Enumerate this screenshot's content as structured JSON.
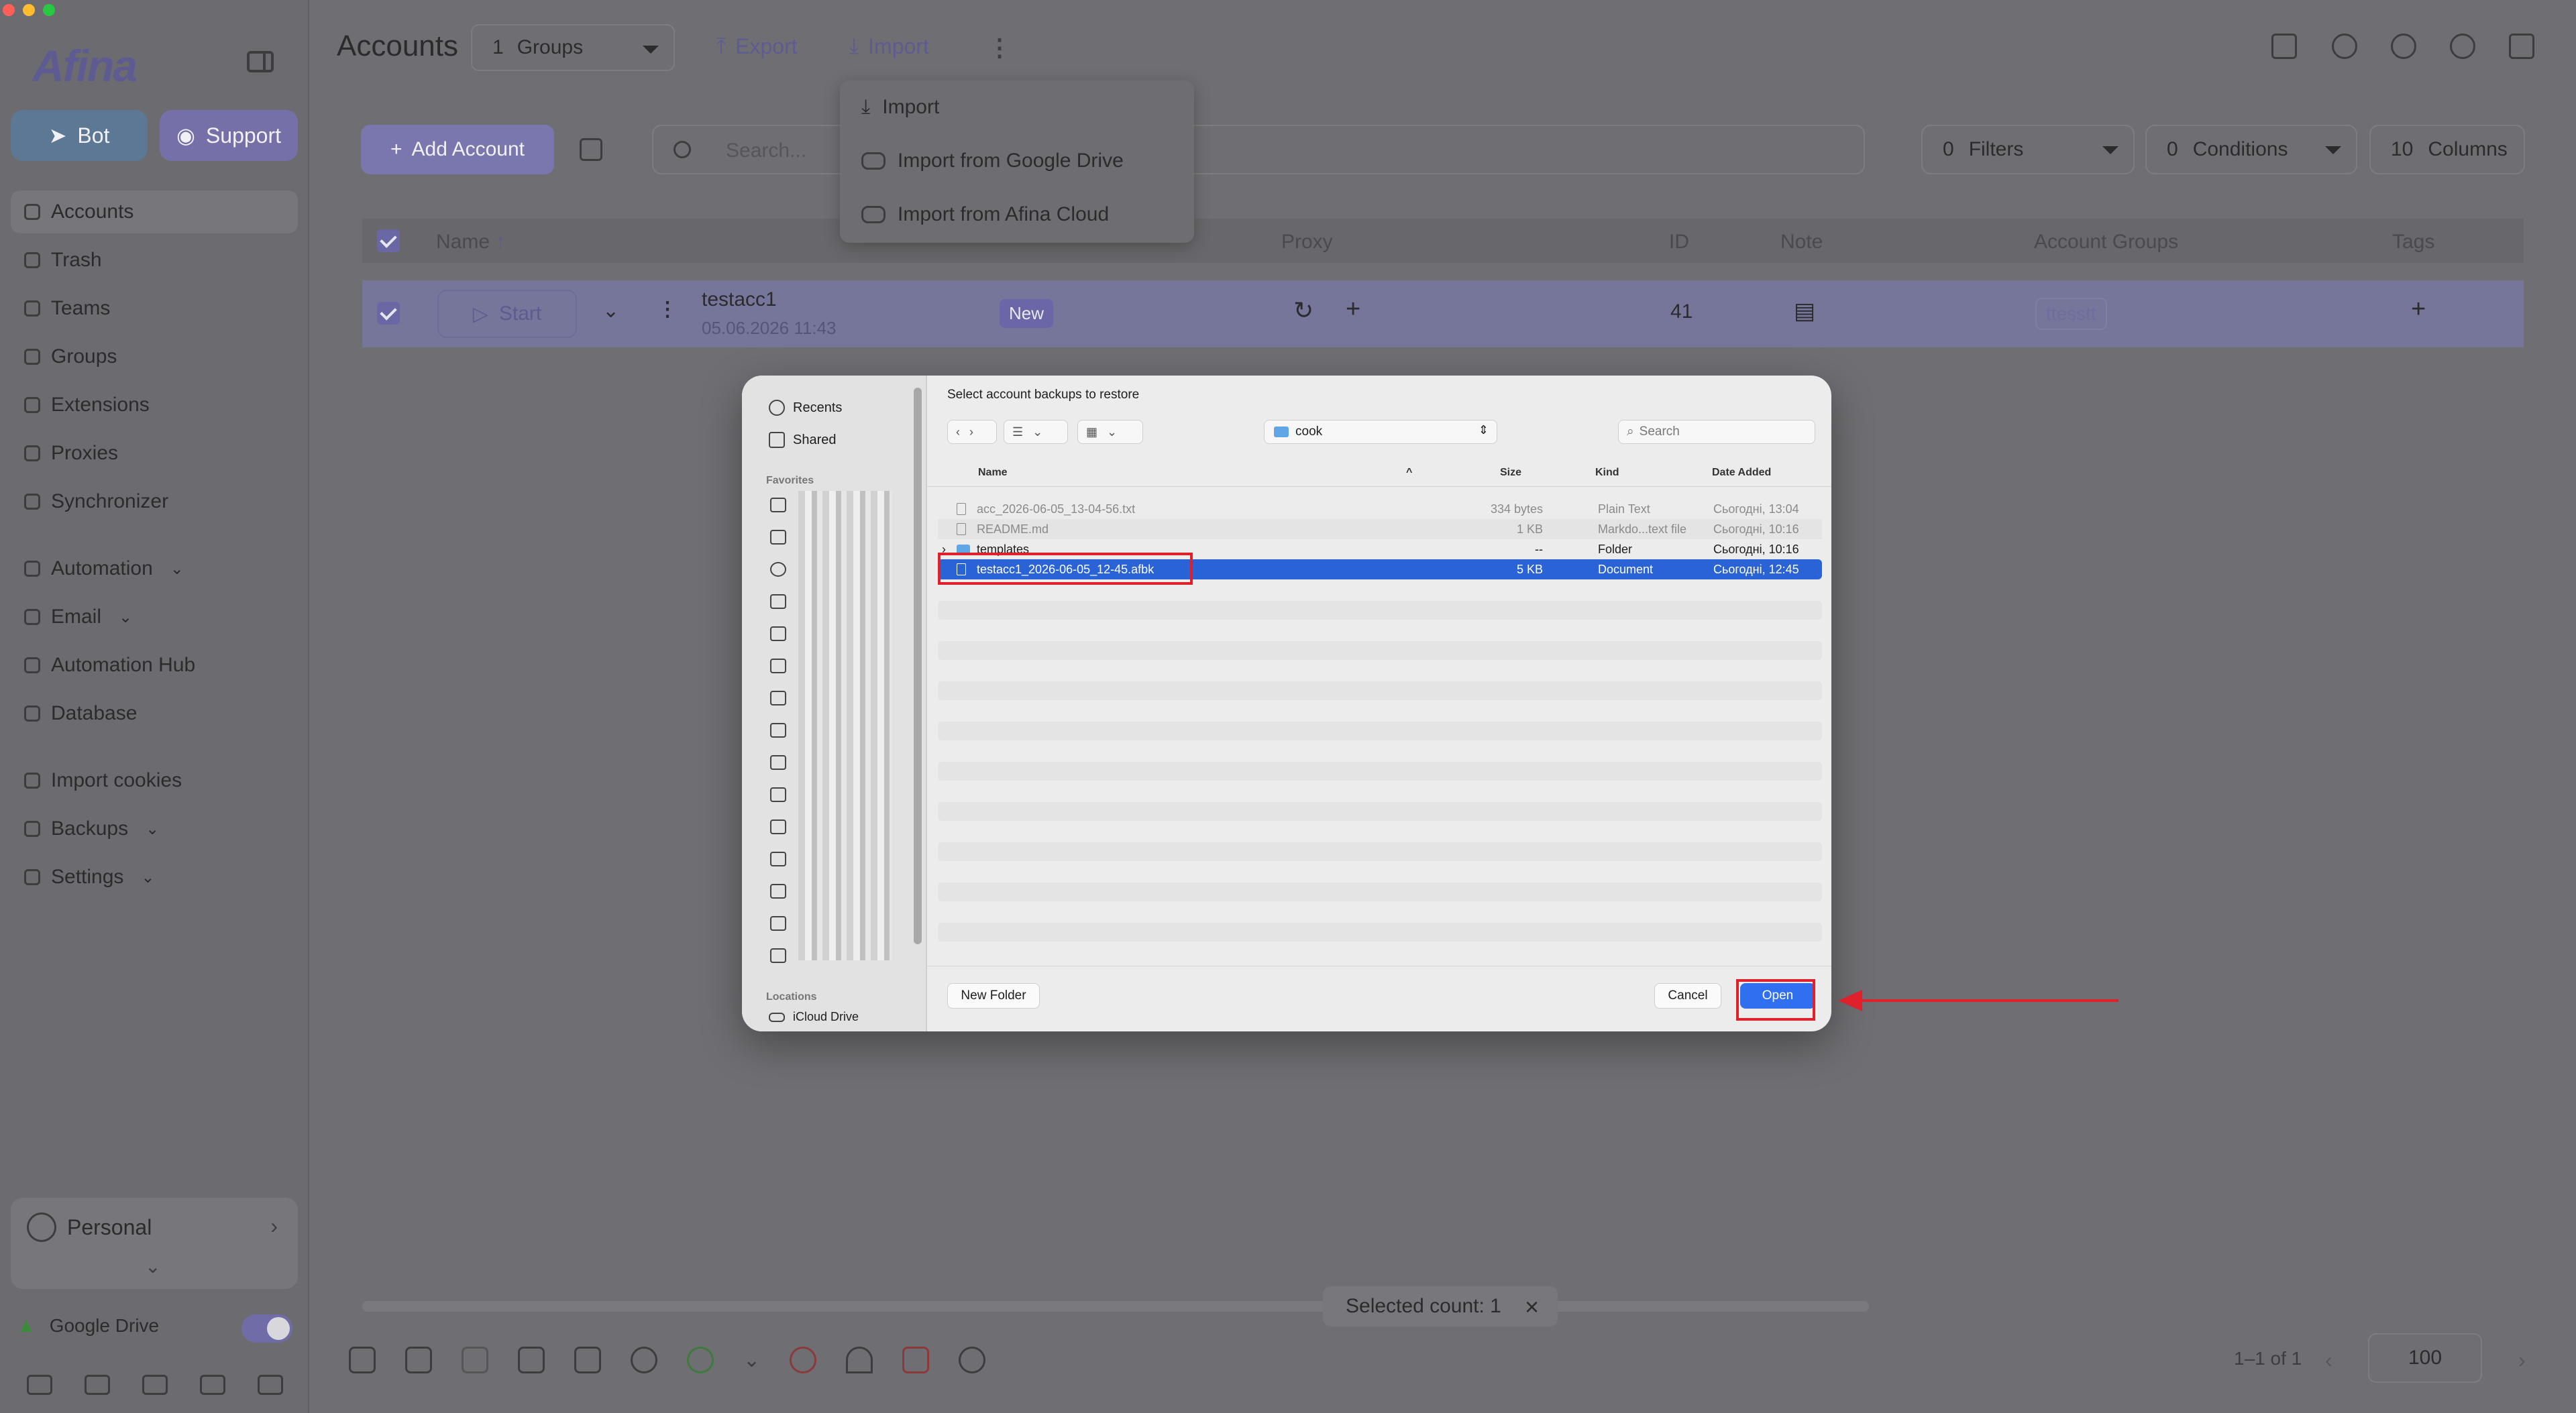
{
  "sidebar": {
    "logo": "Afina",
    "bot_label": "Bot",
    "support_label": "Support",
    "items": [
      {
        "label": "Accounts"
      },
      {
        "label": "Trash"
      },
      {
        "label": "Teams"
      },
      {
        "label": "Groups"
      },
      {
        "label": "Extensions"
      },
      {
        "label": "Proxies"
      },
      {
        "label": "Synchronizer"
      },
      {
        "label": "Automation"
      },
      {
        "label": "Email"
      },
      {
        "label": "Automation Hub"
      },
      {
        "label": "Database"
      },
      {
        "label": "Import cookies"
      },
      {
        "label": "Backups"
      },
      {
        "label": "Settings"
      }
    ],
    "workspace": "Personal",
    "google_drive_label": "Google Drive",
    "google_drive_enabled": true
  },
  "header": {
    "title": "Accounts",
    "groups_count": "1",
    "groups_label": "Groups",
    "export_label": "Export",
    "import_label": "Import"
  },
  "import_menu": {
    "items": [
      {
        "label": "Import"
      },
      {
        "label": "Import from Google Drive"
      },
      {
        "label": "Import from Afina Cloud"
      }
    ]
  },
  "toolbar": {
    "add_account_label": "Add Account",
    "search_placeholder": "Search...",
    "filters_count": "0",
    "filters_label": "Filters",
    "conditions_count": "0",
    "conditions_label": "Conditions",
    "columns_count": "10",
    "columns_label": "Columns"
  },
  "table": {
    "headers": {
      "name": "Name",
      "proxy": "Proxy",
      "id": "ID",
      "note": "Note",
      "account_groups": "Account Groups",
      "tags": "Tags"
    },
    "rows": [
      {
        "start_label": "Start",
        "name": "testacc1",
        "date": "05.06.2026 11:43",
        "status": "New",
        "id": "41",
        "group": "ttesstt"
      }
    ]
  },
  "dialog": {
    "title": "Select account backups to restore",
    "sidebar": {
      "recents": "Recents",
      "shared": "Shared",
      "favorites_header": "Favorites",
      "locations_header": "Locations",
      "icloud": "iCloud Drive"
    },
    "folder": "cook",
    "search_placeholder": "Search",
    "columns": {
      "name": "Name",
      "size": "Size",
      "kind": "Kind",
      "date_added": "Date Added"
    },
    "files": [
      {
        "name": "acc_2026-06-05_13-04-56.txt",
        "size": "334 bytes",
        "kind": "Plain Text",
        "date": "Сьогодні, 13:04"
      },
      {
        "name": "README.md",
        "size": "1 KB",
        "kind": "Markdo...text file",
        "date": "Сьогодні, 10:16"
      },
      {
        "name": "templates",
        "size": "--",
        "kind": "Folder",
        "date": "Сьогодні, 10:16"
      },
      {
        "name": "testacc1_2026-06-05_12-45.afbk",
        "size": "5 KB",
        "kind": "Document",
        "date": "Сьогодні, 12:45"
      }
    ],
    "new_folder_label": "New Folder",
    "cancel_label": "Cancel",
    "open_label": "Open"
  },
  "footer": {
    "selected_count_label": "Selected count: 1",
    "pagination": "1–1 of 1",
    "page_size": "100"
  },
  "colors": {
    "accent": "#7a76ae",
    "highlight": "#e0202a",
    "selection": "#2a63d6",
    "primary_button": "#2f6ff0"
  }
}
